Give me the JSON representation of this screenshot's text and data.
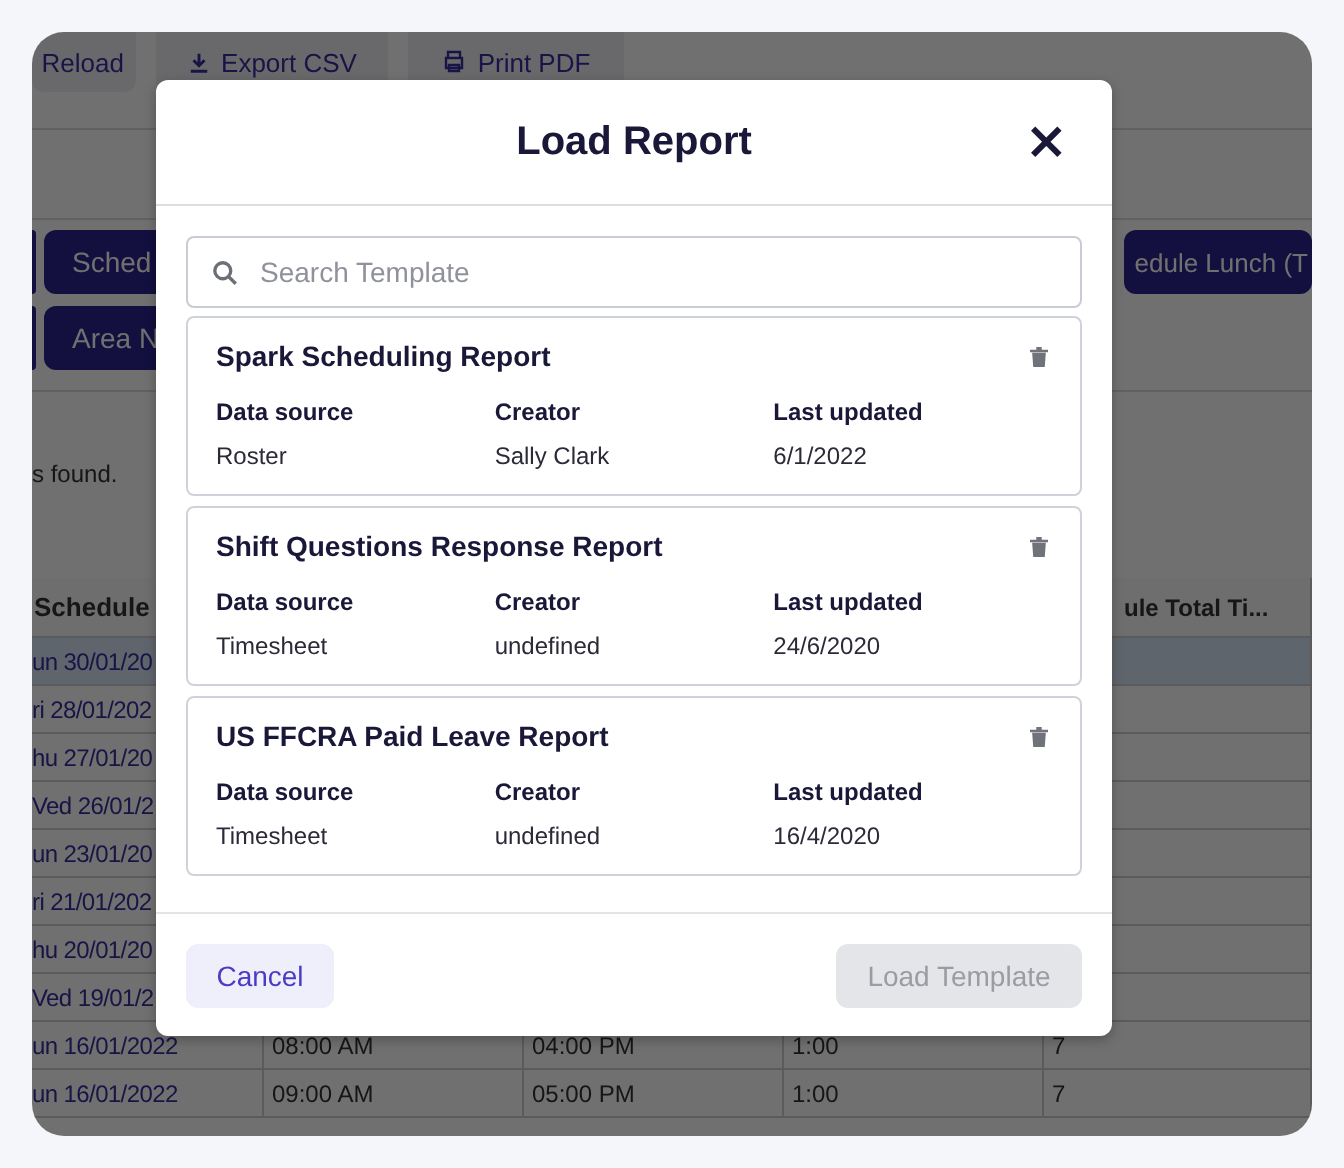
{
  "toolbar": [
    {
      "label": "Reload",
      "kind": "plain"
    },
    {
      "label": "Export CSV",
      "kind": "download"
    },
    {
      "label": "Print PDF",
      "kind": "print"
    }
  ],
  "filter_chips": [
    [
      {
        "kind": "stub"
      },
      {
        "label": "Sched",
        "kind": "left"
      },
      {
        "label": "edule Lunch (T",
        "kind": "right"
      }
    ],
    [
      {
        "kind": "stub"
      },
      {
        "label": "Area N",
        "kind": "left"
      }
    ]
  ],
  "result_text": "s found.",
  "table": {
    "header": {
      "column_1": "Schedule",
      "column_5": "ule Total Ti..."
    },
    "rows": [
      {
        "cells": [
          "un 30/01/20"
        ],
        "selected": true
      },
      {
        "cells": [
          "ri 28/01/202"
        ],
        "selected": false
      },
      {
        "cells": [
          "hu 27/01/20"
        ],
        "selected": false
      },
      {
        "cells": [
          "Ved 26/01/2"
        ],
        "selected": false
      },
      {
        "cells": [
          "un 23/01/20"
        ],
        "selected": false
      },
      {
        "cells": [
          "ri 21/01/202"
        ],
        "selected": false
      },
      {
        "cells": [
          "hu 20/01/20"
        ],
        "selected": false
      },
      {
        "cells": [
          "Ved 19/01/2"
        ],
        "selected": false
      },
      {
        "cells": [
          "un 16/01/2022",
          "08:00 AM",
          "04:00 PM",
          "1:00",
          "7"
        ],
        "selected": false
      },
      {
        "cells": [
          "un 16/01/2022",
          "09:00 AM",
          "05:00 PM",
          "1:00",
          "7"
        ],
        "selected": false
      }
    ]
  },
  "modal": {
    "title": "Load Report",
    "close": "×",
    "search": {
      "placeholder": "Search Template"
    },
    "templates": [
      {
        "name": "Spark Scheduling Report",
        "fields": [
          {
            "label": "Data source",
            "value": "Roster"
          },
          {
            "label": "Creator",
            "value": "Sally Clark"
          },
          {
            "label": "Last updated",
            "value": "6/1/2022"
          }
        ]
      },
      {
        "name": "Shift Questions Response Report",
        "fields": [
          {
            "label": "Data source",
            "value": "Timesheet"
          },
          {
            "label": "Creator",
            "value": "undefined"
          },
          {
            "label": "Last updated",
            "value": "24/6/2020"
          }
        ]
      },
      {
        "name": "US FFCRA Paid Leave Report",
        "fields": [
          {
            "label": "Data source",
            "value": "Timesheet"
          },
          {
            "label": "Creator",
            "value": "undefined"
          },
          {
            "label": "Last updated",
            "value": "16/4/2020"
          }
        ]
      }
    ],
    "buttons": [
      {
        "label": "Cancel",
        "disabled": false
      },
      {
        "label": "Load Template",
        "disabled": true
      }
    ]
  }
}
